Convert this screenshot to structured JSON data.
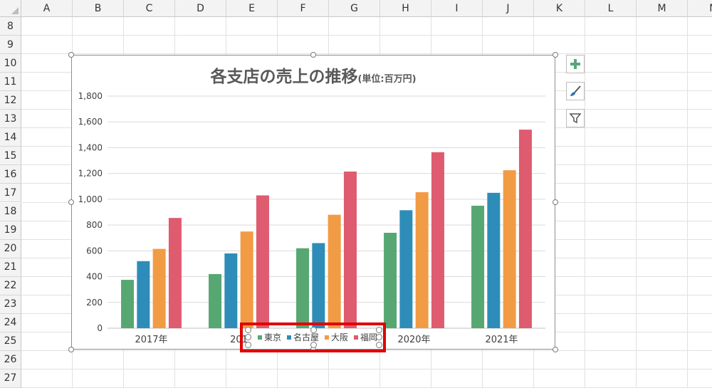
{
  "columns": [
    "A",
    "B",
    "C",
    "D",
    "E",
    "F",
    "G",
    "H",
    "I",
    "J",
    "K",
    "L",
    "M",
    "N"
  ],
  "rows": [
    "8",
    "9",
    "10",
    "11",
    "12",
    "13",
    "14",
    "15",
    "16",
    "17",
    "18",
    "19",
    "20",
    "21",
    "22",
    "23",
    "24",
    "25",
    "26",
    "27"
  ],
  "chart": {
    "title": "各支店の売上の推移",
    "subtitle": "(単位:百万円)",
    "legend_items": [
      "東京",
      "名古屋",
      "大阪",
      "福岡"
    ]
  },
  "chart_data": {
    "type": "bar",
    "title": "各支店の売上の推移(単位:百万円)",
    "categories": [
      "2017年",
      "2018年",
      "2019年",
      "2020年",
      "2021年"
    ],
    "category_labels_visible": [
      "2017年",
      "201",
      "",
      "2020年",
      "2021年"
    ],
    "ylim": [
      0,
      1800
    ],
    "yticks": [
      "0",
      "200",
      "400",
      "600",
      "800",
      "1,000",
      "1,200",
      "1,400",
      "1,600",
      "1,800"
    ],
    "grid": true,
    "legend_position": "bottom",
    "series": [
      {
        "name": "東京",
        "color": "#57a773",
        "values": [
          375,
          420,
          620,
          740,
          950
        ]
      },
      {
        "name": "名古屋",
        "color": "#2e8db8",
        "values": [
          520,
          580,
          660,
          915,
          1050
        ]
      },
      {
        "name": "大阪",
        "color": "#f29b45",
        "values": [
          615,
          750,
          880,
          1055,
          1225
        ]
      },
      {
        "name": "福岡",
        "color": "#df5b6f",
        "values": [
          855,
          1030,
          1215,
          1365,
          1540
        ]
      }
    ]
  },
  "side_buttons": {
    "elements_icon": "plus-icon",
    "styles_icon": "brush-icon",
    "filter_icon": "filter-icon"
  }
}
